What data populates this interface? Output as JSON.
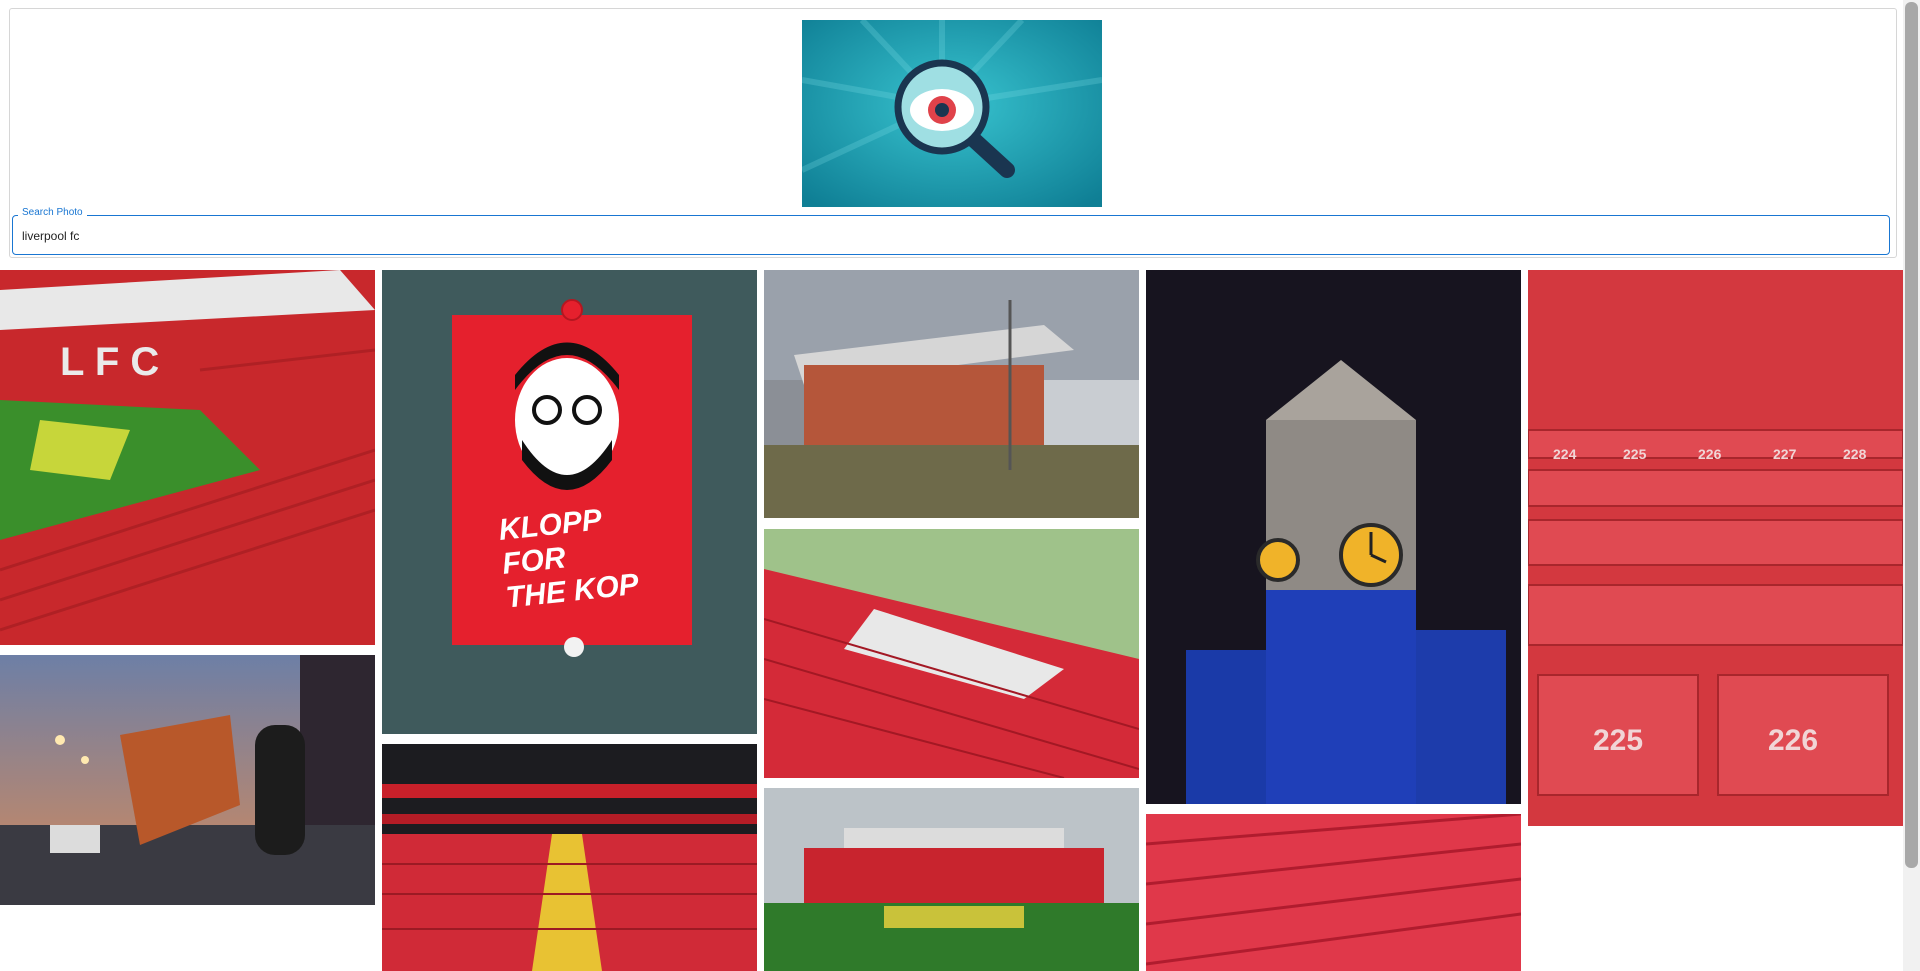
{
  "search": {
    "legend": "Search Photo",
    "value": "liverpool fc"
  },
  "logo": {
    "icon": "magnifier-eye-icon",
    "bg": "#1aa3b4"
  },
  "poster": {
    "line1": "KLOPP FOR",
    "line2": "THE KOP"
  },
  "seats": {
    "a": "225",
    "b": "226",
    "r1a": "224",
    "r1b": "225",
    "r1c": "226",
    "r1d": "227",
    "r1e": "228"
  },
  "colors": {
    "accent": "#1976d2",
    "red": "#d9232e"
  }
}
